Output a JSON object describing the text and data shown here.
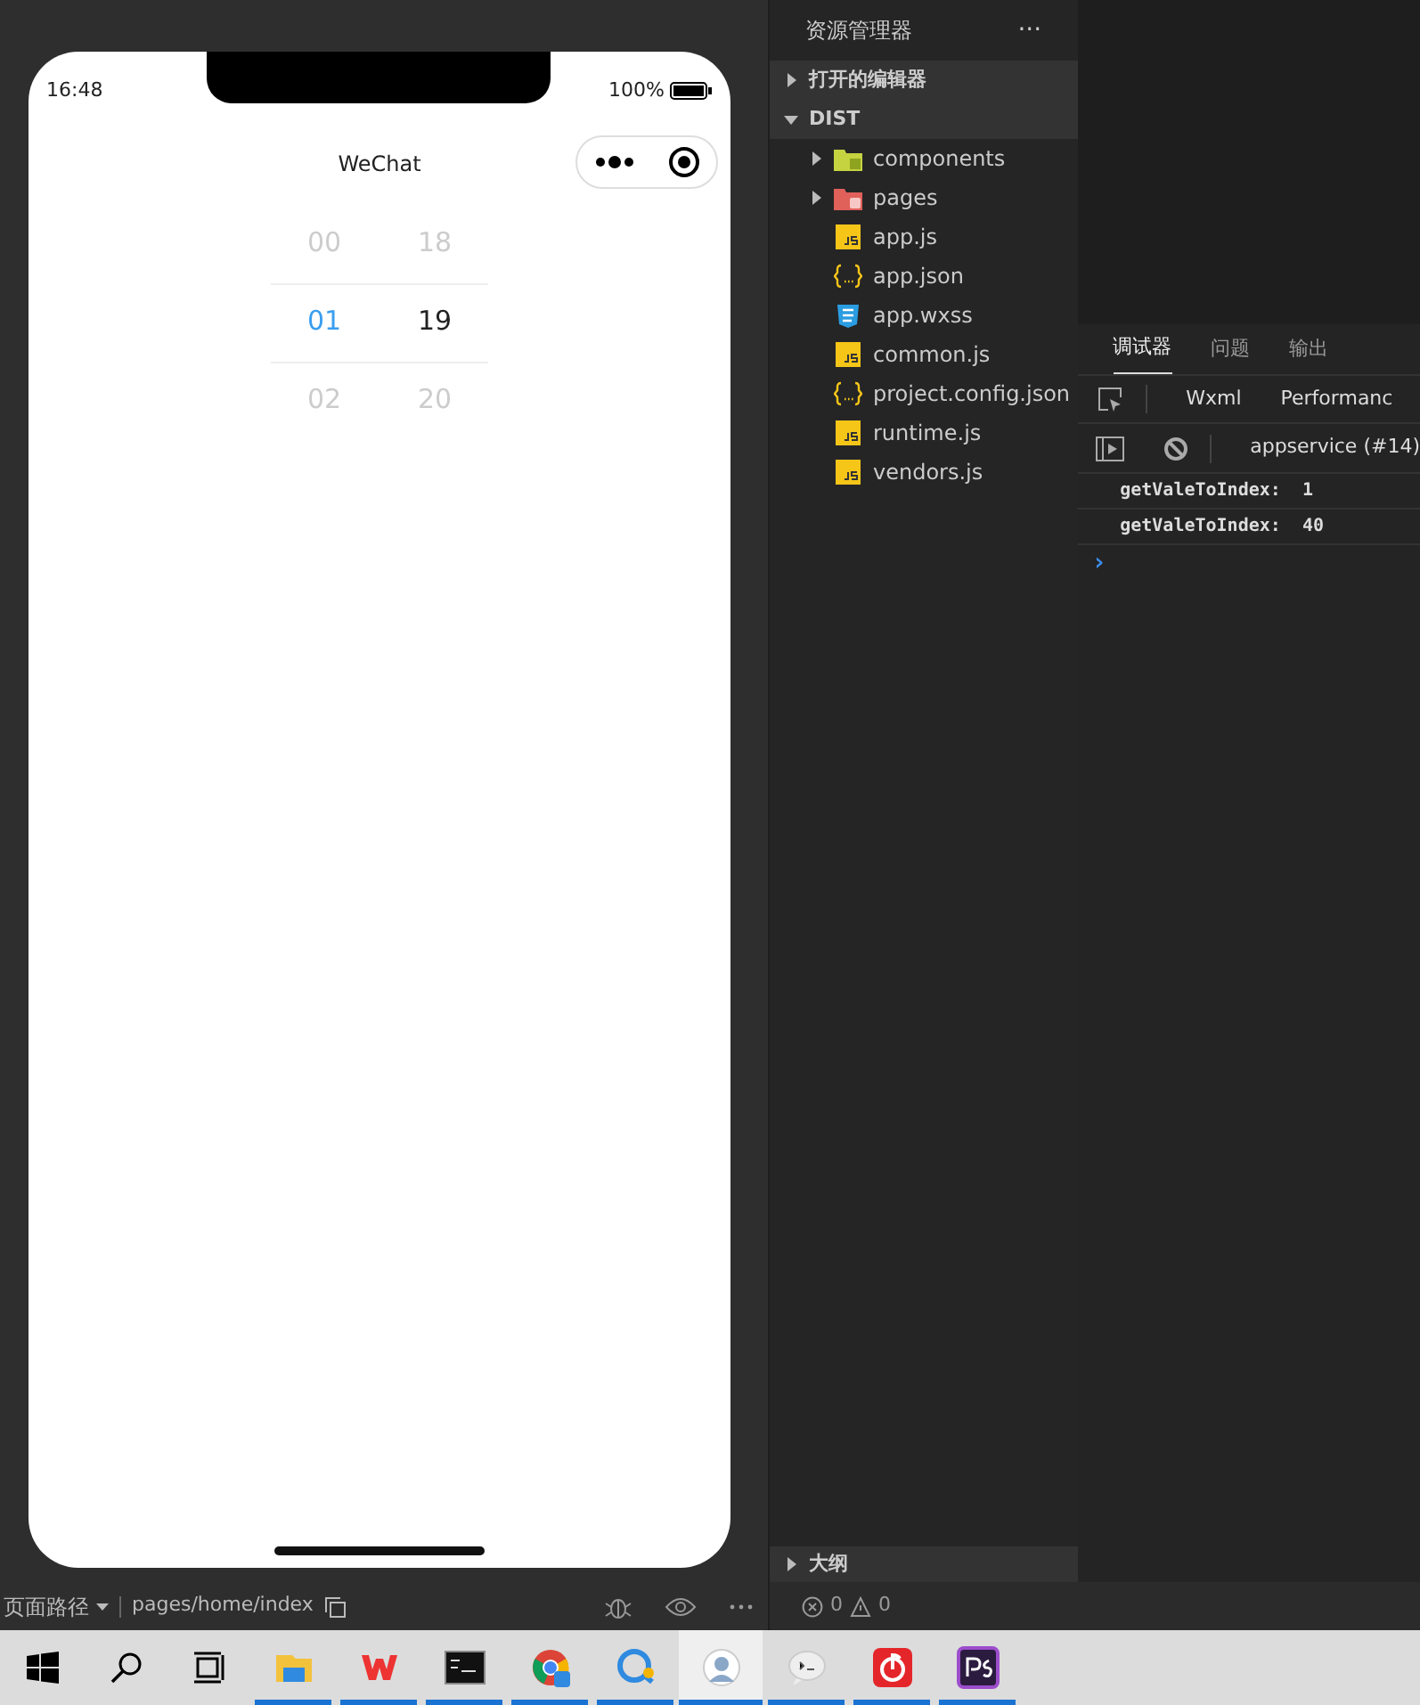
{
  "simulator": {
    "status_time": "16:48",
    "battery_text": "100%",
    "nav_title": "WeChat",
    "picker": [
      {
        "items": [
          {
            "text": "00",
            "selected": false
          },
          {
            "text": "01",
            "selected": true
          },
          {
            "text": "02",
            "selected": false
          }
        ]
      },
      {
        "items": [
          {
            "text": "18",
            "selected": false
          },
          {
            "text": "19",
            "selected": true
          },
          {
            "text": "20",
            "selected": false
          }
        ]
      }
    ]
  },
  "simulator_bar": {
    "path_label": "页面路径",
    "path": "pages/home/index"
  },
  "explorer": {
    "title": "资源管理器",
    "more": "···",
    "sections": [
      {
        "label": "打开的编辑器",
        "expanded": false
      },
      {
        "label": "DIST",
        "expanded": true,
        "items": [
          {
            "name": "components",
            "kind": "folder-green",
            "expanded": false
          },
          {
            "name": "pages",
            "kind": "folder-red",
            "expanded": false
          },
          {
            "name": "app.js",
            "kind": "js"
          },
          {
            "name": "app.json",
            "kind": "json"
          },
          {
            "name": "app.wxss",
            "kind": "css"
          },
          {
            "name": "common.js",
            "kind": "js"
          },
          {
            "name": "project.config.json",
            "kind": "json"
          },
          {
            "name": "runtime.js",
            "kind": "js"
          },
          {
            "name": "vendors.js",
            "kind": "js"
          }
        ]
      }
    ],
    "outline": {
      "label": "大纲",
      "expanded": false
    }
  },
  "debugger": {
    "tabs": [
      {
        "label": "调试器",
        "selected": true
      },
      {
        "label": "问题",
        "selected": false
      },
      {
        "label": "输出",
        "selected": false
      }
    ],
    "subtabs": [
      {
        "label": "Wxml"
      },
      {
        "label": "Performanc"
      }
    ],
    "context": "appservice (#14)",
    "console": [
      {
        "text": "getValeToIndex:  1"
      },
      {
        "text": "getValeToIndex:  40"
      }
    ],
    "prompt": "›"
  },
  "status_bar": {
    "errors": "0",
    "warnings": "0"
  },
  "taskbar": {
    "apps": [
      {
        "kind": "explorer",
        "active": false
      },
      {
        "kind": "wps",
        "active": false
      },
      {
        "kind": "terminal",
        "active": false
      },
      {
        "kind": "chrome",
        "active": false
      },
      {
        "kind": "chat",
        "active": false
      },
      {
        "kind": "avatar",
        "active": true
      },
      {
        "kind": "bubble",
        "active": false
      },
      {
        "kind": "music",
        "active": false
      },
      {
        "kind": "ps",
        "active": false
      }
    ]
  }
}
